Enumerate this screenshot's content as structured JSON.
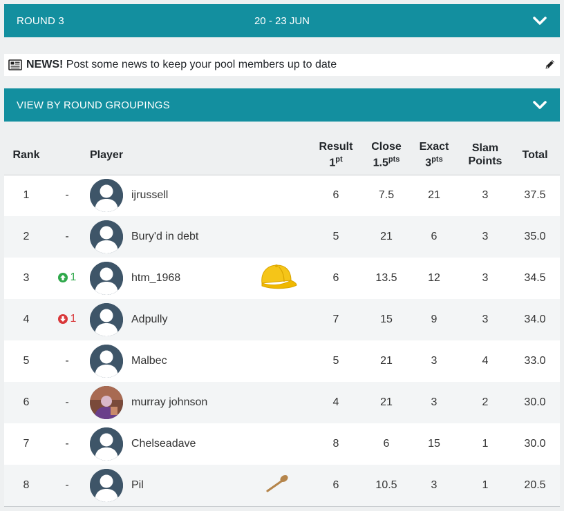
{
  "round_bar": {
    "label": "ROUND 3",
    "dates": "20 - 23 JUN"
  },
  "news": {
    "label": "NEWS!",
    "text": "Post some news to keep your pool members up to date"
  },
  "groupings_bar": {
    "label": "VIEW BY ROUND GROUPINGS"
  },
  "colors": {
    "teal": "#138f9f",
    "up": "#2ea84a",
    "down": "#d9383a"
  },
  "table": {
    "headers": {
      "rank": "Rank",
      "player": "Player",
      "result": "Result",
      "result_pts": "1",
      "result_sup": "pt",
      "close": "Close",
      "close_pts": "1.5",
      "close_sup": "pts",
      "exact": "Exact",
      "exact_pts": "3",
      "exact_sup": "pts",
      "slam": "Slam",
      "slam_sub": "Points",
      "total": "Total"
    },
    "rows": [
      {
        "rank": "1",
        "move": "-",
        "move_dir": "none",
        "player": "ijrussell",
        "avatar": "default",
        "badge": "",
        "result": "6",
        "close": "7.5",
        "exact": "21",
        "slam": "3",
        "total": "37.5"
      },
      {
        "rank": "2",
        "move": "-",
        "move_dir": "none",
        "player": "Bury'd in debt",
        "avatar": "default",
        "badge": "",
        "result": "5",
        "close": "21",
        "exact": "6",
        "slam": "3",
        "total": "35.0"
      },
      {
        "rank": "3",
        "move": "1",
        "move_dir": "up",
        "player": "htm_1968",
        "avatar": "default",
        "badge": "cap-icon",
        "result": "6",
        "close": "13.5",
        "exact": "12",
        "slam": "3",
        "total": "34.5"
      },
      {
        "rank": "4",
        "move": "1",
        "move_dir": "down",
        "player": "Adpully",
        "avatar": "default",
        "badge": "",
        "result": "7",
        "close": "15",
        "exact": "9",
        "slam": "3",
        "total": "34.0"
      },
      {
        "rank": "5",
        "move": "-",
        "move_dir": "none",
        "player": "Malbec",
        "avatar": "default",
        "badge": "",
        "result": "5",
        "close": "21",
        "exact": "3",
        "slam": "4",
        "total": "33.0"
      },
      {
        "rank": "6",
        "move": "-",
        "move_dir": "none",
        "player": "murray johnson",
        "avatar": "photo",
        "badge": "",
        "result": "4",
        "close": "21",
        "exact": "3",
        "slam": "2",
        "total": "30.0"
      },
      {
        "rank": "7",
        "move": "-",
        "move_dir": "none",
        "player": "Chelseadave",
        "avatar": "default",
        "badge": "",
        "result": "8",
        "close": "6",
        "exact": "15",
        "slam": "1",
        "total": "30.0"
      },
      {
        "rank": "8",
        "move": "-",
        "move_dir": "none",
        "player": "Pil",
        "avatar": "default",
        "badge": "spoon-icon",
        "result": "6",
        "close": "10.5",
        "exact": "3",
        "slam": "1",
        "total": "20.5"
      }
    ]
  }
}
